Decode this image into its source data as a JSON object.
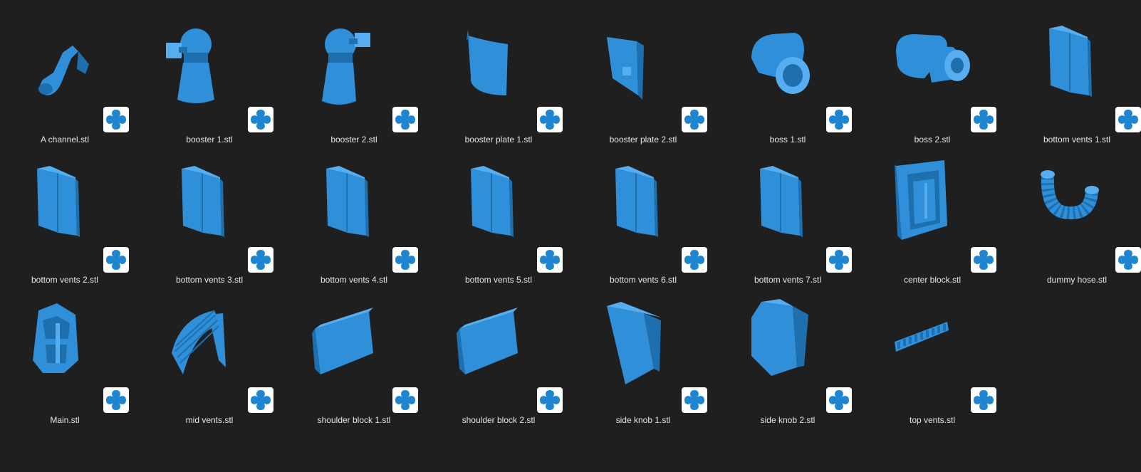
{
  "colors": {
    "background": "#1f1f1f",
    "model": "#2f8fd8",
    "badge_bg": "#ffffff",
    "badge_mark": "#1e86d0",
    "label": "#e6e6e6"
  },
  "files": [
    {
      "name": "A channel.stl",
      "shape": "channel",
      "badge_icon": "app-clover-icon"
    },
    {
      "name": "booster 1.stl",
      "shape": "booster-left",
      "badge_icon": "app-clover-icon"
    },
    {
      "name": "booster 2.stl",
      "shape": "booster-right",
      "badge_icon": "app-clover-icon"
    },
    {
      "name": "booster plate 1.stl",
      "shape": "plate",
      "badge_icon": "app-clover-icon"
    },
    {
      "name": "booster plate 2.stl",
      "shape": "plate-2",
      "badge_icon": "app-clover-icon"
    },
    {
      "name": "boss 1.stl",
      "shape": "boss-left",
      "badge_icon": "app-clover-icon"
    },
    {
      "name": "boss 2.stl",
      "shape": "boss-right",
      "badge_icon": "app-clover-icon"
    },
    {
      "name": "bottom vents 1.stl",
      "shape": "vent",
      "badge_icon": "app-clover-icon"
    },
    {
      "name": "bottom vents 2.stl",
      "shape": "vent",
      "badge_icon": "app-clover-icon"
    },
    {
      "name": "bottom vents 3.stl",
      "shape": "vent",
      "badge_icon": "app-clover-icon"
    },
    {
      "name": "bottom vents 4.stl",
      "shape": "vent",
      "badge_icon": "app-clover-icon"
    },
    {
      "name": "bottom vents 5.stl",
      "shape": "vent",
      "badge_icon": "app-clover-icon"
    },
    {
      "name": "bottom vents 6.stl",
      "shape": "vent",
      "badge_icon": "app-clover-icon"
    },
    {
      "name": "bottom vents 7.stl",
      "shape": "vent",
      "badge_icon": "app-clover-icon"
    },
    {
      "name": "center block.stl",
      "shape": "center-block",
      "badge_icon": "app-clover-icon"
    },
    {
      "name": "dummy hose.stl",
      "shape": "hose",
      "badge_icon": "app-clover-icon"
    },
    {
      "name": "Main.stl",
      "shape": "main",
      "badge_icon": "app-clover-icon"
    },
    {
      "name": "mid vents.stl",
      "shape": "mid-vents",
      "badge_icon": "app-clover-icon"
    },
    {
      "name": "shoulder block 1.stl",
      "shape": "shoulder",
      "badge_icon": "app-clover-icon"
    },
    {
      "name": "shoulder block 2.stl",
      "shape": "shoulder",
      "badge_icon": "app-clover-icon"
    },
    {
      "name": "side knob 1.stl",
      "shape": "knob-1",
      "badge_icon": "app-clover-icon"
    },
    {
      "name": "side knob 2.stl",
      "shape": "knob-2",
      "badge_icon": "app-clover-icon"
    },
    {
      "name": "top vents.stl",
      "shape": "top-vents",
      "badge_icon": "app-clover-icon"
    }
  ]
}
